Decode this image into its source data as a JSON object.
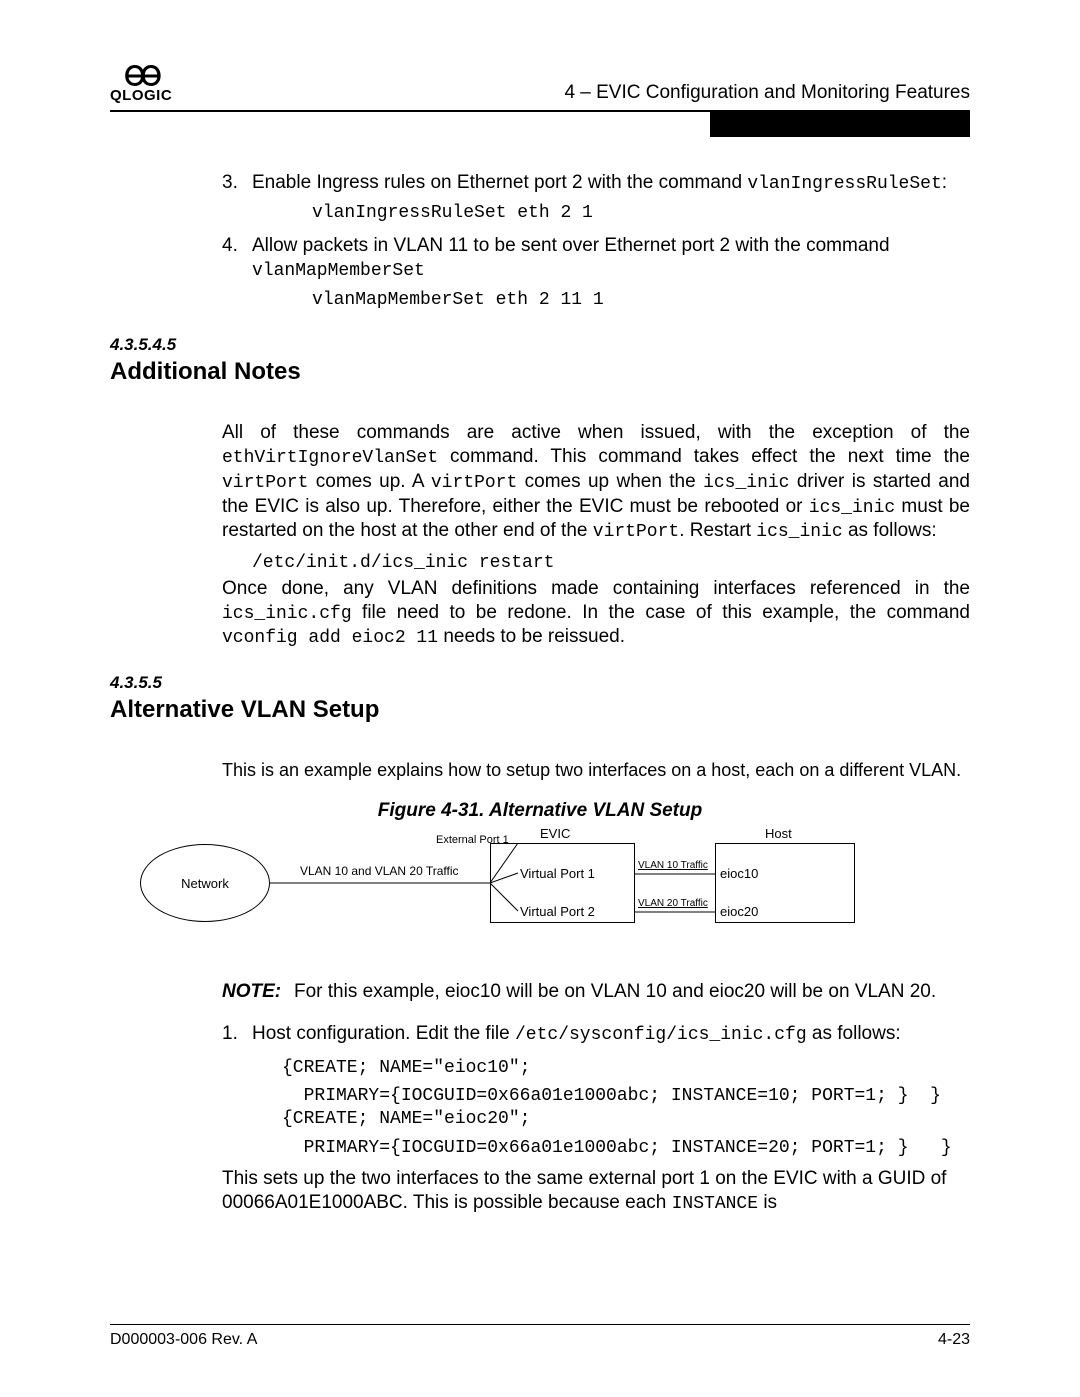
{
  "header": {
    "logo_top": "ᎾᎾ",
    "logo_text": "QLOGIC",
    "chapter": "4 – EVIC Configuration and Monitoring Features"
  },
  "step3": {
    "num": "3.",
    "text_a": "Enable Ingress rules on Ethernet port 2 with the command ",
    "code_inline": "vlanIngressRuleSet",
    "colon": ":",
    "code_line": "vlanIngressRuleSet eth 2 1"
  },
  "step4": {
    "num": "4.",
    "text_a": "Allow packets in VLAN 11 to be sent over Ethernet port 2 with the command ",
    "code_inline": "vlanMapMemberSet",
    "code_line": "vlanMapMemberSet eth 2 11 1"
  },
  "sec1": {
    "num": "4.3.5.4.5",
    "title": "Additional Notes",
    "p1_a": "All of these commands are active when issued, with the exception of the ",
    "p1_c1": "ethVirtIgnoreVlanSet",
    "p1_b": " command. This command takes effect the next time the ",
    "p1_c2": "virtPort",
    "p1_c": " comes up. A ",
    "p1_c3": "virtPort",
    "p1_d": " comes up when the ",
    "p1_c4": "ics_inic",
    "p1_e": " driver is started and the EVIC is also up. Therefore, either the EVIC must be rebooted or ",
    "p1_c5": "ics_inic",
    "p1_f": " must be restarted on the host at the other end of the ",
    "p1_c6": "virtPort",
    "p1_g": ". Restart ",
    "p1_c7": "ics_inic",
    "p1_h": " as follows:",
    "code": "/etc/init.d/ics_inic restart",
    "p2_a": "Once done, any VLAN definitions made containing interfaces referenced in the ",
    "p2_c1": "ics_inic.cfg",
    "p2_b": " file need to be redone. In the case of this example, the command ",
    "p2_c2": "vconfig add eioc2 11",
    "p2_c": " needs to be reissued."
  },
  "sec2": {
    "num": "4.3.5.5",
    "title": "Alternative VLAN Setup",
    "intro": "This is an example explains how to setup two interfaces on a host, each on a different VLAN.",
    "fig_caption": "Figure 4-31. Alternative VLAN Setup"
  },
  "diagram": {
    "network": "Network",
    "traffic_combo": "VLAN 10 and VLAN 20 Traffic",
    "ext_port": "External Port 1",
    "evic": "EVIC",
    "vp1": "Virtual Port 1",
    "vp2": "Virtual Port 2",
    "v10": "VLAN 10 Traffic",
    "v20": "VLAN 20 Traffic",
    "host": "Host",
    "e10": "eioc10",
    "e20": "eioc20"
  },
  "note": {
    "label": "NOTE:",
    "text": "For this example, eioc10 will be on VLAN 10 and eioc20 will be on VLAN 20."
  },
  "step1b": {
    "num": "1.",
    "text_a": "Host configuration. Edit the file ",
    "code_path": "/etc/sysconfig/ics_inic.cfg",
    "text_b": " as follows:",
    "code_l1": "{CREATE; NAME=\"eioc10\";",
    "code_l2": "  PRIMARY={IOCGUID=0x66a01e1000abc; INSTANCE=10; PORT=1; }  }",
    "code_l3": "{CREATE; NAME=\"eioc20\";",
    "code_l4": "  PRIMARY={IOCGUID=0x66a01e1000abc; INSTANCE=20; PORT=1; }   }",
    "after_a": "This sets up the two interfaces to the same external port 1 on the EVIC with a GUID of 00066A01E1000ABC. This is possible because each ",
    "after_code": "INSTANCE",
    "after_b": " is"
  },
  "footer": {
    "left": "D000003-006 Rev. A",
    "right": "4-23"
  }
}
